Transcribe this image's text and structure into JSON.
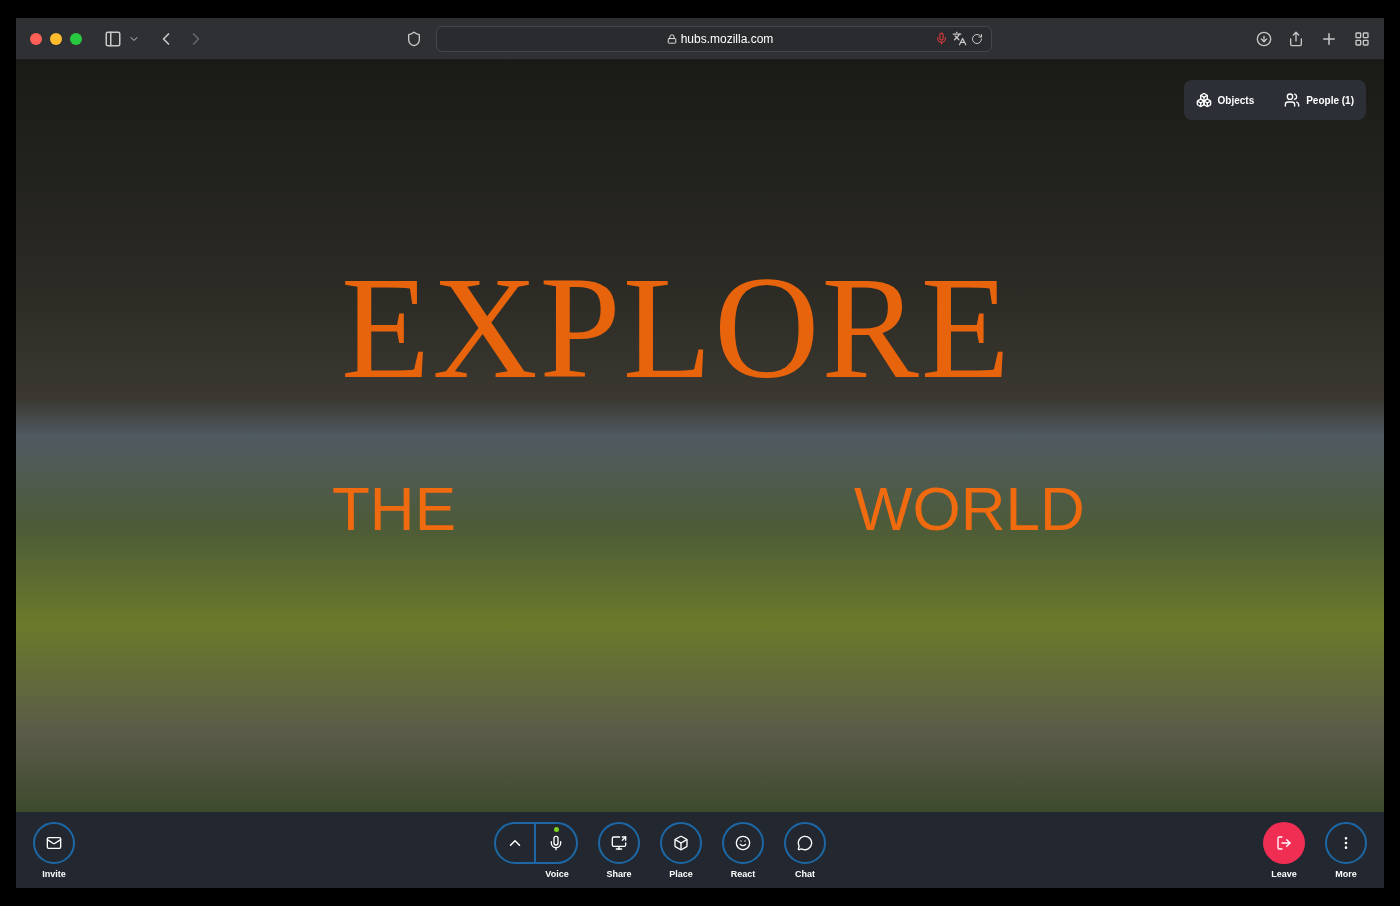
{
  "browser": {
    "url": "hubs.mozilla.com",
    "back_disabled": false,
    "forward_disabled": true,
    "mic_recording": true
  },
  "scene": {
    "sign_lines": [
      {
        "text": "EXPLORE",
        "kind": "title"
      },
      {
        "text": "THE",
        "kind": "left"
      },
      {
        "text": "WORLD",
        "kind": "right"
      }
    ]
  },
  "top_panel": [
    {
      "label": "Objects",
      "kind": "objects"
    },
    {
      "label": "People (1)",
      "kind": "people"
    }
  ],
  "toolbar": {
    "left": [
      {
        "label": "Invite",
        "kind": "invite"
      }
    ],
    "center": [
      {
        "label": "Voice",
        "kind": "voice",
        "mic_live": true
      },
      {
        "label": "Share",
        "kind": "share"
      },
      {
        "label": "Place",
        "kind": "place"
      },
      {
        "label": "React",
        "kind": "react"
      },
      {
        "label": "Chat",
        "kind": "chat"
      }
    ],
    "right": [
      {
        "label": "Leave",
        "kind": "leave"
      },
      {
        "label": "More",
        "kind": "more"
      }
    ]
  }
}
